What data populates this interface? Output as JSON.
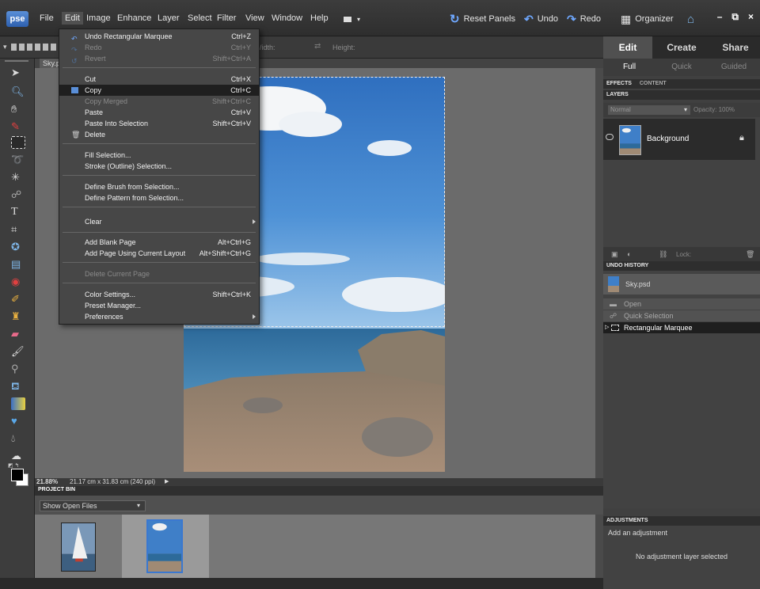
{
  "app": {
    "logo": "pse"
  },
  "menubar": {
    "items": [
      "File",
      "Edit",
      "Image",
      "Enhance",
      "Layer",
      "Select",
      "Filter",
      "View",
      "Window",
      "Help"
    ],
    "reset_panels": "Reset Panels",
    "undo": "Undo",
    "redo": "Redo",
    "organizer": "Organizer"
  },
  "options_bar": {
    "width_label": "Width:",
    "height_label": "Height:"
  },
  "document": {
    "tab_label": "Sky.psd",
    "zoom": "21.88%",
    "dimensions": "21.17 cm x 31.83 cm (240 ppi)"
  },
  "edit_menu": {
    "items": [
      {
        "label": "Undo Rectangular Marquee",
        "shortcut": "Ctrl+Z",
        "enabled": true
      },
      {
        "label": "Redo",
        "shortcut": "Ctrl+Y",
        "enabled": false
      },
      {
        "label": "Revert",
        "shortcut": "Shift+Ctrl+A",
        "enabled": false
      },
      {
        "label": "Cut",
        "shortcut": "Ctrl+X",
        "enabled": true
      },
      {
        "label": "Copy",
        "shortcut": "Ctrl+C",
        "enabled": true,
        "highlighted": true
      },
      {
        "label": "Copy Merged",
        "shortcut": "Shift+Ctrl+C",
        "enabled": false
      },
      {
        "label": "Paste",
        "shortcut": "Ctrl+V",
        "enabled": true
      },
      {
        "label": "Paste Into Selection",
        "shortcut": "Shift+Ctrl+V",
        "enabled": true
      },
      {
        "label": "Delete",
        "shortcut": "",
        "enabled": true
      },
      {
        "label": "Fill Selection...",
        "shortcut": "",
        "enabled": true
      },
      {
        "label": "Stroke (Outline) Selection...",
        "shortcut": "",
        "enabled": true
      },
      {
        "label": "Define Brush from Selection...",
        "shortcut": "",
        "enabled": true
      },
      {
        "label": "Define Pattern from Selection...",
        "shortcut": "",
        "enabled": true
      },
      {
        "label": "Clear",
        "shortcut": "",
        "enabled": true,
        "submenu": true
      },
      {
        "label": "Add Blank Page",
        "shortcut": "Alt+Ctrl+G",
        "enabled": true
      },
      {
        "label": "Add Page Using Current Layout",
        "shortcut": "Alt+Shift+Ctrl+G",
        "enabled": true
      },
      {
        "label": "Delete Current Page",
        "shortcut": "",
        "enabled": false
      },
      {
        "label": "Color Settings...",
        "shortcut": "Shift+Ctrl+K",
        "enabled": true
      },
      {
        "label": "Preset Manager...",
        "shortcut": "",
        "enabled": true
      },
      {
        "label": "Preferences",
        "shortcut": "",
        "enabled": true,
        "submenu": true
      }
    ]
  },
  "project_bin": {
    "title": "PROJECT BIN",
    "filter": "Show Open Files"
  },
  "right_panel": {
    "mode_tabs": [
      "Edit",
      "Create",
      "Share"
    ],
    "sub_tabs": [
      "Full",
      "Quick",
      "Guided"
    ],
    "effects_tab": "EFFECTS",
    "content_tab": "CONTENT",
    "layers_title": "LAYERS",
    "blend_mode": "Normal",
    "opacity_label": "Opacity:",
    "opacity_value": "100%",
    "layer_name": "Background",
    "lock_label": "Lock:",
    "history_title": "UNDO HISTORY",
    "history_file": "Sky.psd",
    "history_items": [
      "Open",
      "Quick Selection",
      "Rectangular Marquee"
    ],
    "adjustments_title": "ADJUSTMENTS",
    "adjustments_hint": "Add an adjustment",
    "adjustments_empty": "No adjustment layer selected"
  }
}
